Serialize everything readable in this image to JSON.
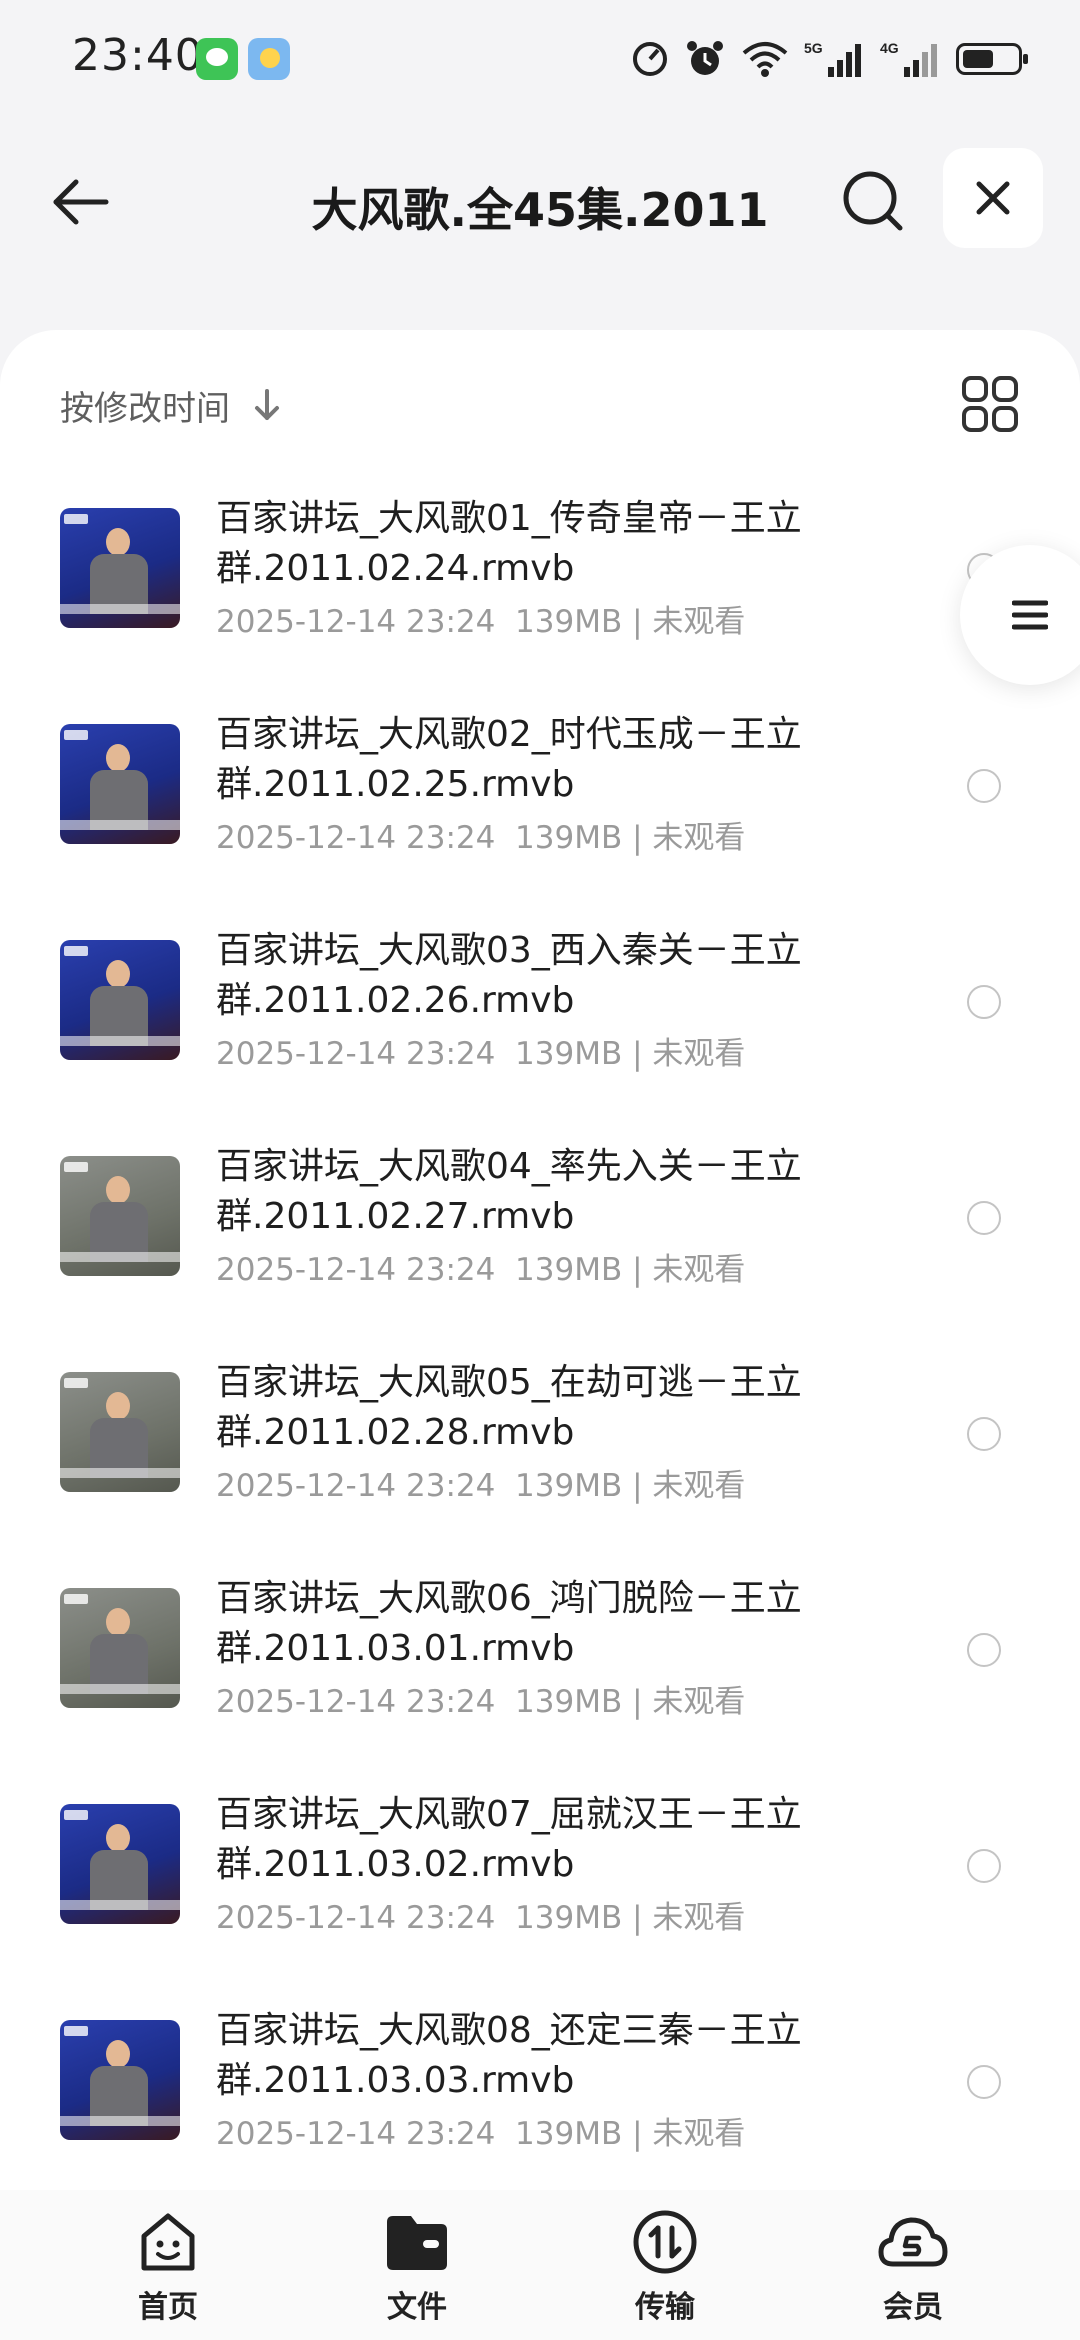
{
  "status_bar": {
    "time": "23:40",
    "icons": [
      "app-notification-icon",
      "weather-icon",
      "speed-icon",
      "alarm-icon",
      "wifi-icon",
      "signal-5g-icon",
      "signal-4g-icon",
      "battery-icon"
    ],
    "battery_level": 0.55
  },
  "header": {
    "title": "大风歌.全45集.2011",
    "back_icon": "arrow-left-icon",
    "search_icon": "search-icon",
    "close_icon": "close-icon"
  },
  "toolbar": {
    "sort_label": "按修改时间",
    "sort_icon": "arrow-down-icon",
    "view_icon": "grid-view-icon"
  },
  "files": [
    {
      "name": "百家讲坛_大风歌01_传奇皇帝－王立群.2011.02.24.rmvb",
      "meta": "2025-12-14 23:24  139MB | 未观看",
      "thumb": "blue"
    },
    {
      "name": "百家讲坛_大风歌02_时代玉成－王立群.2011.02.25.rmvb",
      "meta": "2025-12-14 23:24  139MB | 未观看",
      "thumb": "blue"
    },
    {
      "name": "百家讲坛_大风歌03_西入秦关－王立群.2011.02.26.rmvb",
      "meta": "2025-12-14 23:24  139MB | 未观看",
      "thumb": "blue"
    },
    {
      "name": "百家讲坛_大风歌04_率先入关－王立群.2011.02.27.rmvb",
      "meta": "2025-12-14 23:24  139MB | 未观看",
      "thumb": "gray"
    },
    {
      "name": "百家讲坛_大风歌05_在劫可逃－王立群.2011.02.28.rmvb",
      "meta": "2025-12-14 23:24  139MB | 未观看",
      "thumb": "gray"
    },
    {
      "name": "百家讲坛_大风歌06_鸿门脱险－王立群.2011.03.01.rmvb",
      "meta": "2025-12-14 23:24  139MB | 未观看",
      "thumb": "gray"
    },
    {
      "name": "百家讲坛_大风歌07_屈就汉王－王立群.2011.03.02.rmvb",
      "meta": "2025-12-14 23:24  139MB | 未观看",
      "thumb": "blue"
    },
    {
      "name": "百家讲坛_大风歌08_还定三秦－王立群.2011.03.03.rmvb",
      "meta": "2025-12-14 23:24  139MB | 未观看",
      "thumb": "blue"
    }
  ],
  "side_handle_icon": "menu-icon",
  "bottom_nav": [
    {
      "label": "首页",
      "icon": "home-face-icon"
    },
    {
      "label": "文件",
      "icon": "folder-icon"
    },
    {
      "label": "传输",
      "icon": "transfer-icon"
    },
    {
      "label": "会员",
      "icon": "member-cloud-icon"
    }
  ],
  "colors": {
    "background": "#f4f4f6",
    "card": "#ffffff",
    "text_primary": "#1f1f1f",
    "text_secondary": "#9a9a9a"
  }
}
